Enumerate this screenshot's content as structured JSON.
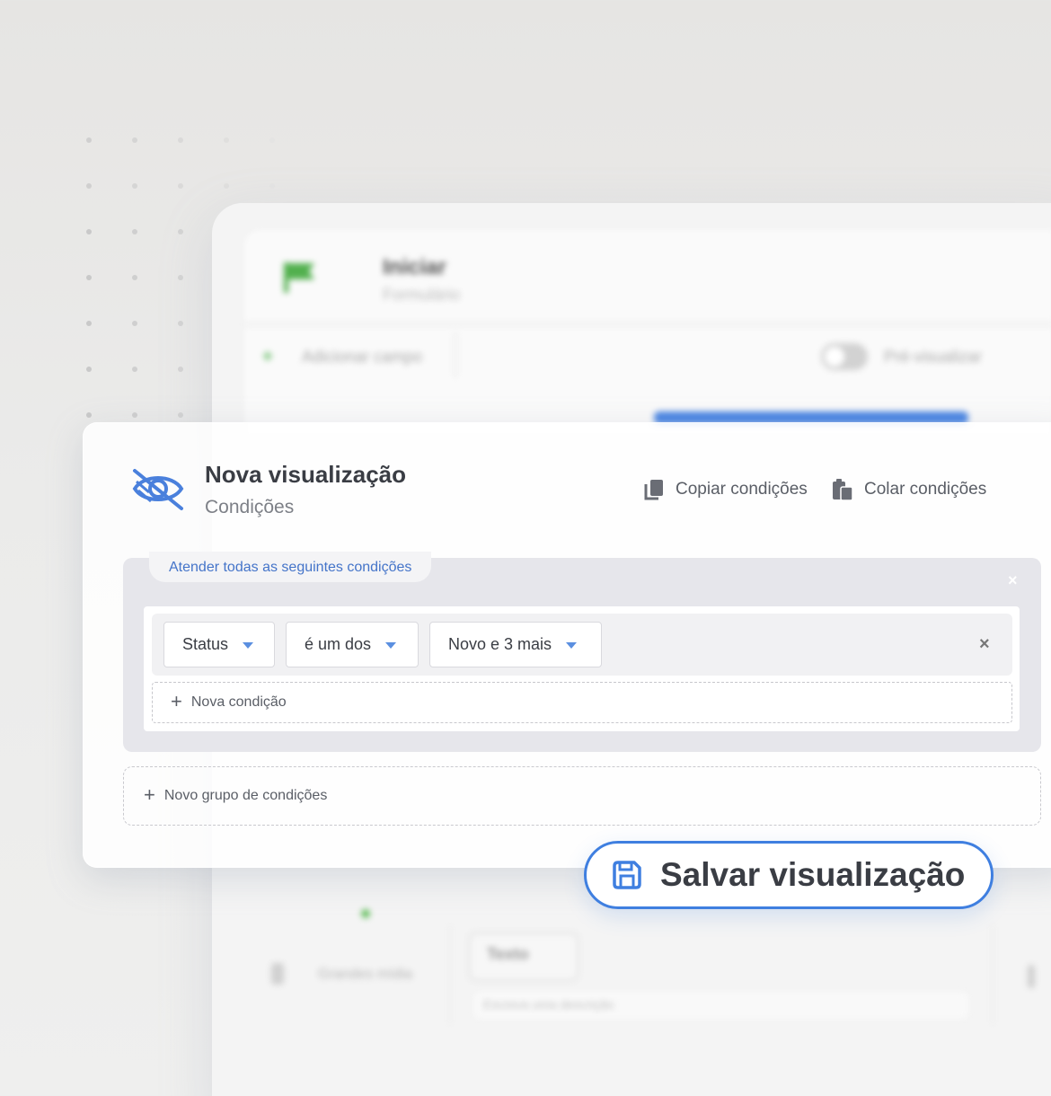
{
  "background_app": {
    "title": "Iniciar",
    "subtitle": "Formulário",
    "add_field_label": "Adicionar campo",
    "preview_label": "Pré-visualizar",
    "hidden_field_label": "Grandes mídia",
    "field_label": "Texto",
    "field_description": "Escreva uma descrição"
  },
  "dialog": {
    "title": "Nova visualização",
    "subtitle": "Condições",
    "copy_label": "Copiar condições",
    "paste_label": "Colar condições"
  },
  "condition_group": {
    "tab_label": "Atender todas as seguintes condições",
    "close_symbol": "×",
    "conditions": [
      {
        "field": "Status",
        "operator": "é um dos",
        "value": "Novo e 3 mais",
        "remove_symbol": "×"
      }
    ],
    "new_condition_label": "Nova condição"
  },
  "new_group_label": "Novo grupo de condições",
  "save_button_label": "Salvar visualização",
  "colors": {
    "accent": "#3f7fe0",
    "link": "#4474c9",
    "group_bg": "#e6e6eb"
  },
  "icons": [
    "hidden-eye-icon",
    "copy-icon",
    "paste-icon",
    "save-icon",
    "flag-icon"
  ]
}
